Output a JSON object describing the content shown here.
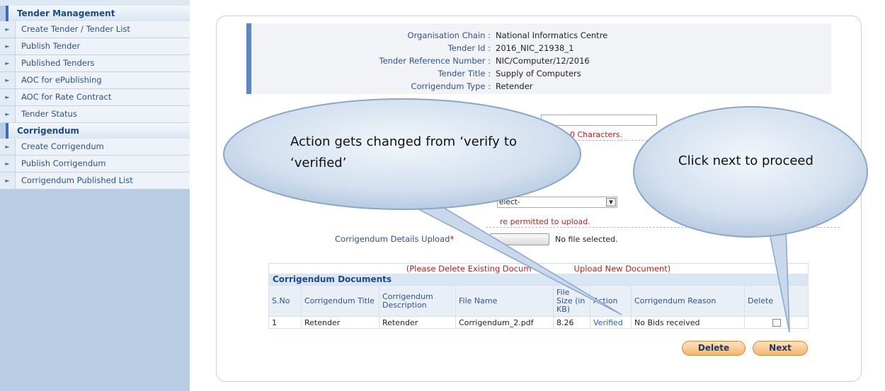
{
  "sidebar": {
    "sections": [
      {
        "title": "Tender Management",
        "items": [
          "Create Tender / Tender List",
          "Publish Tender",
          "Published Tenders",
          "AOC for ePublishing",
          "AOC for Rate Contract",
          "Tender Status"
        ]
      },
      {
        "title": "Corrigendum",
        "items": [
          "Create Corrigendum",
          "Publish Corrigendum",
          "Corrigendum Published List"
        ]
      }
    ]
  },
  "info": {
    "rows": [
      {
        "label": "Organisation Chain :",
        "value": "National Informatics Centre"
      },
      {
        "label": "Tender Id :",
        "value": "2016_NIC_21938_1"
      },
      {
        "label": "Tender Reference Number :",
        "value": "NIC/Computer/12/2016"
      },
      {
        "label": "Tender Title :",
        "value": "Supply of Computers"
      },
      {
        "label": "Corrigendum Type :",
        "value": "Retender"
      }
    ]
  },
  "form": {
    "char_note_partial": "0 Characters.",
    "select_value_partial": "elect-",
    "upload_note_partial": "re permitted to upload.",
    "upload_label": "Corrigendum Details Upload",
    "required_star": "*",
    "file_status": "No file selected."
  },
  "documents": {
    "delete_note_left": "(Please Delete Existing Docum",
    "delete_note_right": "Upload New Document)",
    "title": "Corrigendum Documents",
    "headers": [
      "S.No",
      "Corrigendum Title",
      "Corrigendum Description",
      "File Name",
      "File Size (in KB)",
      "Action",
      "Corrigendum Reason",
      "Delete"
    ],
    "rows": [
      {
        "sno": "1",
        "title": "Retender",
        "description": "Retender",
        "file_name": "Corrigendum_2.pdf",
        "size": "8.26",
        "action": "Verified",
        "reason": "No Bids received"
      }
    ]
  },
  "buttons": {
    "delete": "Delete",
    "next": "Next"
  },
  "callouts": {
    "left": "Action gets changed from ‘verify to ‘verified’",
    "right": "Click next to proceed"
  }
}
